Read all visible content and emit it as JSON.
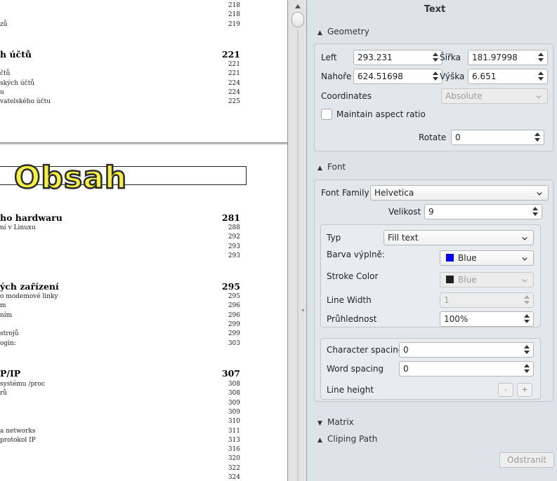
{
  "document": {
    "top_lines": [
      {
        "text": "",
        "num": "218"
      },
      {
        "text": "",
        "num": "218"
      },
      {
        "text": "zů",
        "num": "219"
      }
    ],
    "heading1": {
      "text": "h účtů",
      "num": "221"
    },
    "sec1_lines": [
      {
        "text": "",
        "num": "221"
      },
      {
        "text": "čtů",
        "num": "221"
      },
      {
        "text": "ských účtů",
        "num": "224"
      },
      {
        "text": "u",
        "num": "224"
      },
      {
        "text": "vatelského účtu",
        "num": "225"
      }
    ],
    "title": "Obsah",
    "heading2": {
      "text": "ho hardwaru",
      "num": "281"
    },
    "sec2_lines": [
      {
        "text": "ní v Linuxu",
        "num": "288"
      },
      {
        "text": "",
        "num": "292"
      },
      {
        "text": "",
        "num": "293"
      },
      {
        "text": "",
        "num": "293"
      }
    ],
    "heading3": {
      "text": "ých zařízení",
      "num": "295"
    },
    "sec3_lines": [
      {
        "text": "o modemové linky",
        "num": "295"
      },
      {
        "text": "m",
        "num": "296"
      },
      {
        "text": "ním",
        "num": "296"
      },
      {
        "text": "",
        "num": "299"
      },
      {
        "text": "strojů",
        "num": "299"
      },
      {
        "text": "ogin:",
        "num": "303"
      }
    ],
    "heading4": {
      "text": "P/IP",
      "num": "307"
    },
    "sec4_lines": [
      {
        "text": "systému /proc",
        "num": "308"
      },
      {
        "text": "rů",
        "num": "308"
      },
      {
        "text": "",
        "num": "309"
      },
      {
        "text": "",
        "num": "309"
      },
      {
        "text": "",
        "num": "310"
      },
      {
        "text": "a networks",
        "num": "311"
      },
      {
        "text": "protokol IP",
        "num": "313"
      },
      {
        "text": "",
        "num": "316"
      },
      {
        "text": "",
        "num": "320"
      },
      {
        "text": "",
        "num": "322"
      },
      {
        "text": "",
        "num": "324"
      }
    ]
  },
  "panel": {
    "title": "Text",
    "geometry": {
      "header": "Geometry",
      "left_label": "Left",
      "left_value": "293.231",
      "width_label": "Šířka",
      "width_value": "181.97998",
      "top_label": "Nahoře",
      "top_value": "624.51698",
      "height_label": "Výška",
      "height_value": "6.651",
      "coords_label": "Coordinates",
      "coords_value": "Absolute",
      "aspect_label": "Maintain aspect ratio",
      "rotate_label": "Rotate",
      "rotate_value": "0"
    },
    "font": {
      "header": "Font",
      "family_label": "Font Family",
      "family_value": "Helvetica",
      "size_label": "Velikost",
      "size_value": "9",
      "type_label": "Typ",
      "type_value": "Fill text",
      "fill_label": "Barva výplně:",
      "fill_value": "Blue",
      "fill_color": "#0000ff",
      "stroke_label": "Stroke Color",
      "stroke_value": "Blue",
      "stroke_color": "#222222",
      "line_width_label": "Line Width",
      "line_width_value": "1",
      "opacity_label": "Průhlednost",
      "opacity_value": "100%",
      "char_spacing_label": "Character spacing",
      "char_spacing_value": "0",
      "word_spacing_label": "Word spacing",
      "word_spacing_value": "0",
      "line_height_label": "Line height",
      "minus": "-",
      "plus": "+"
    },
    "matrix_header": "Matrix",
    "clipping_header": "Cliping Path",
    "remove_button": "Odstranit"
  }
}
